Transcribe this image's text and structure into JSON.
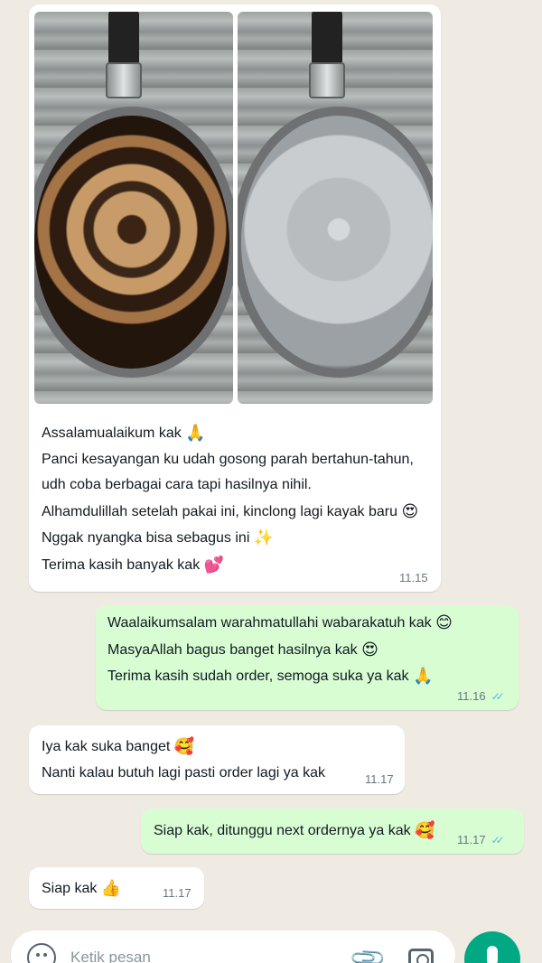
{
  "messages": [
    {
      "type": "incoming",
      "has_images": true,
      "lines": [
        {
          "text": "Assalamualaikum kak",
          "emoji": "🙏"
        },
        {
          "text": "Panci kesayangan ku udah gosong parah bertahun-tahun,",
          "emoji": ""
        },
        {
          "text": "udh coba berbagai cara tapi hasilnya nihil.",
          "emoji": ""
        },
        {
          "text": "Alhamdulillah setelah pakai ini, kinclong lagi kayak baru",
          "emoji": "😍"
        },
        {
          "text": "Nggak nyangka bisa sebagus ini",
          "emoji": "✨"
        },
        {
          "text": "Terima kasih banyak kak",
          "emoji": "💕"
        }
      ],
      "time": "11.15"
    },
    {
      "type": "outgoing",
      "lines": [
        {
          "text": "Waalaikumsalam warahmatullahi wabarakatuh kak",
          "emoji": "😊"
        },
        {
          "text": "MasyaAllah bagus banget hasilnya kak",
          "emoji": "😍"
        },
        {
          "text": "Terima kasih sudah order, semoga suka ya kak",
          "emoji": "🙏"
        }
      ],
      "time": "11.16",
      "ticks": "✓✓"
    },
    {
      "type": "incoming",
      "lines": [
        {
          "text": "Iya kak suka banget",
          "emoji": "🥰"
        },
        {
          "text": "Nanti kalau butuh lagi pasti order lagi ya kak",
          "emoji": ""
        }
      ],
      "time": "11.17"
    },
    {
      "type": "outgoing",
      "lines": [
        {
          "text": "Siap kak, ditunggu next ordernya ya kak",
          "emoji": "🥰"
        }
      ],
      "time": "11.17",
      "ticks": "✓✓"
    },
    {
      "type": "incoming",
      "lines": [
        {
          "text": "Siap kak",
          "emoji": "👍"
        }
      ],
      "time": "11.17"
    }
  ],
  "input": {
    "placeholder": "Ketik pesan",
    "emoji_icon": "emoji-icon",
    "attach_icon": "paperclip-icon",
    "camera_icon": "camera-icon",
    "mic_icon": "microphone-icon"
  },
  "colors": {
    "background": "#efeae2",
    "incoming_bubble": "#ffffff",
    "outgoing_bubble": "#d9fdd3",
    "read_ticks": "#53bdeb",
    "accent": "#00a884"
  }
}
